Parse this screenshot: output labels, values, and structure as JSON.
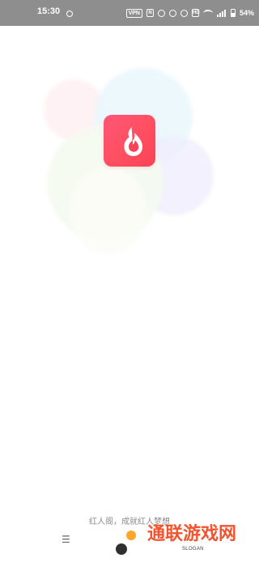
{
  "status_bar": {
    "time": "15:30",
    "vpn_label": "VPN",
    "nfc_label": "N",
    "hd_label": "HD",
    "battery_percent": "54%",
    "battery_level": 54
  },
  "app": {
    "slogan": "红人阁，成就红人梦想"
  },
  "watermark": {
    "name": "通联游戏网",
    "tagline": "SLOGAN"
  },
  "colors": {
    "icon_top": "#ff5676",
    "icon_bottom": "#f84357",
    "watermark_orange": "#f2542f",
    "status_bg": "#8e8e8e"
  }
}
